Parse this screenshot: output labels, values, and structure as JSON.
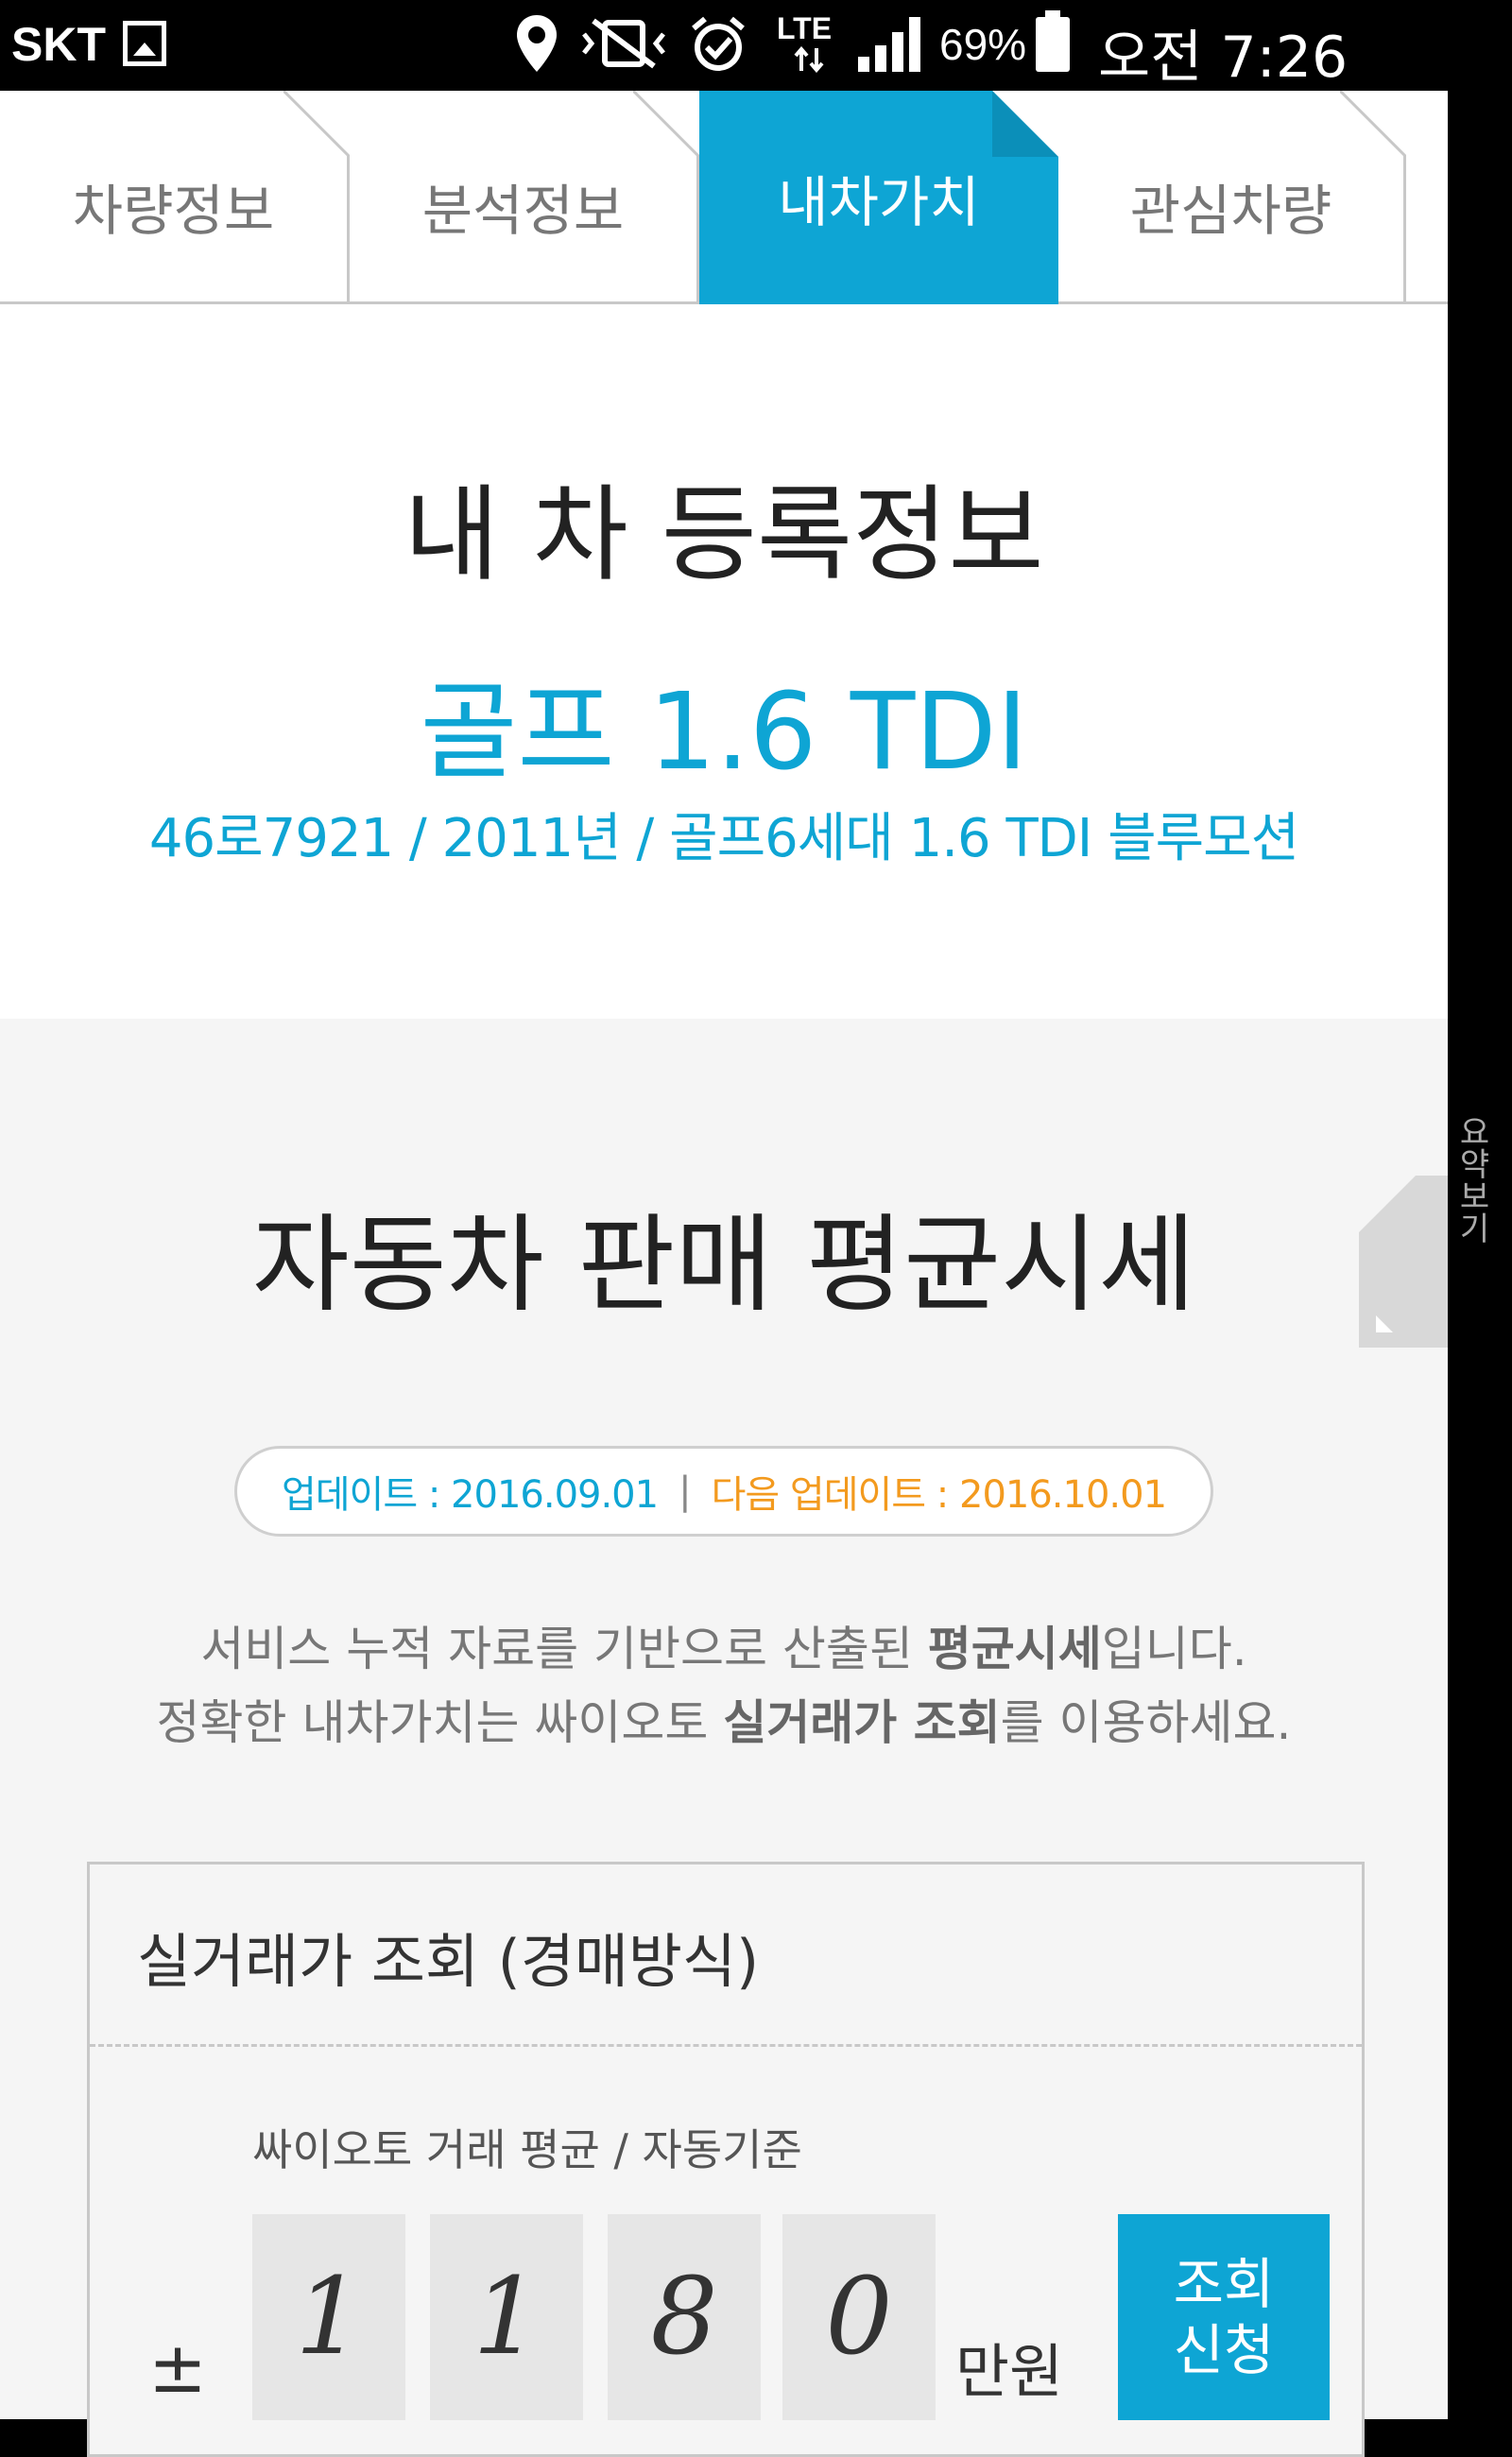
{
  "status_bar": {
    "carrier": "SKT",
    "network": "LTE",
    "battery": "69%",
    "time": "오전 7:26"
  },
  "tabs": [
    {
      "label": "차량정보",
      "active": false
    },
    {
      "label": "분석정보",
      "active": false
    },
    {
      "label": "내차가치",
      "active": true
    },
    {
      "label": "관심차량",
      "active": false
    }
  ],
  "registration": {
    "title": "내 차 등록정보",
    "model": "골프 1.6 TDI",
    "detail": "46로7921 / 2011년 / 골프6세대 1.6 TDI 블루모션"
  },
  "side_label": "요약보기",
  "average": {
    "title": "자동차 판매 평균시세",
    "update_label": "업데이트 : 2016.09.01",
    "separator": "|",
    "next_update_label": "다음 업데이트 : 2016.10.01",
    "desc_line1_pre": "서비스 누적 자료를 기반으로 산출된 ",
    "desc_line1_bold": "평균시세",
    "desc_line1_post": "입니다.",
    "desc_line2_pre": "정확한 내차가치는 싸이오토 ",
    "desc_line2_bold": "실거래가 조회",
    "desc_line2_post": "를 이용하세요."
  },
  "lookup": {
    "title": "실거래가 조회 (경매방식)",
    "subtitle": "싸이오토 거래 평균 / 자동기준",
    "plus_minus": "±",
    "digits": [
      "1",
      "1",
      "8",
      "0"
    ],
    "unit": "만원",
    "button_line1": "조회",
    "button_line2": "신청"
  },
  "colors": {
    "accent": "#0ea5d4",
    "orange": "#f39a1e"
  }
}
